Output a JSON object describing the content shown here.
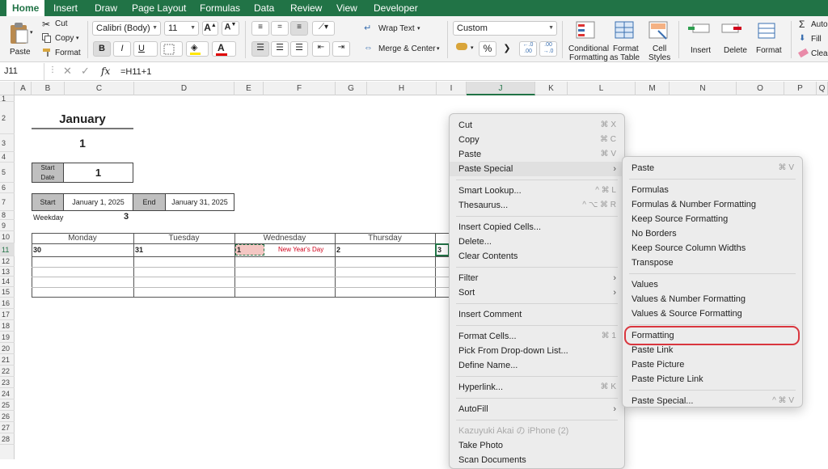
{
  "ribbon_tabs": [
    "Home",
    "Insert",
    "Draw",
    "Page Layout",
    "Formulas",
    "Data",
    "Review",
    "View",
    "Developer"
  ],
  "clipboard": {
    "paste": "Paste",
    "cut": "Cut",
    "copy": "Copy",
    "format": "Format"
  },
  "font": {
    "name": "Calibri (Body)",
    "size": "11",
    "bold": "B",
    "italic": "I",
    "underline": "U",
    "grow": "A",
    "shrink": "A",
    "font_color": "A"
  },
  "alignment": {
    "wrap_text": "Wrap Text",
    "merge_center": "Merge & Center"
  },
  "number": {
    "format": "Custom",
    "percent": "%",
    "comma": "❯",
    "inc_decimal": "←.0\n.00",
    "dec_decimal": ".00\n→.0"
  },
  "styles": {
    "conditional": [
      "Conditional",
      "Formatting"
    ],
    "format_table": [
      "Format",
      "as Table"
    ],
    "cell_styles": [
      "Cell",
      "Styles"
    ]
  },
  "cells": {
    "insert": "Insert",
    "delete": "Delete",
    "format": "Format"
  },
  "editing": {
    "autosum": "Auto",
    "fill": "Fill",
    "clear": "Clear"
  },
  "formula_bar": {
    "name_box": "J11",
    "fx": "fx",
    "formula": "=H11+1"
  },
  "columns": [
    "A",
    "B",
    "C",
    "D",
    "E",
    "F",
    "G",
    "H",
    "I",
    "J",
    "K",
    "L",
    "M",
    "N",
    "O",
    "P",
    "Q"
  ],
  "rows": [
    "1",
    "2",
    "3",
    "4",
    "5",
    "6",
    "7",
    "8",
    "9",
    "10",
    "11",
    "12",
    "13",
    "14",
    "15",
    "16",
    "17",
    "18",
    "19",
    "20",
    "21",
    "22",
    "23",
    "24",
    "25",
    "26",
    "27",
    "28"
  ],
  "sheet": {
    "month": "January",
    "month_number": "1",
    "start_date_label": [
      "Start",
      "Date"
    ],
    "start_date_value": "1",
    "start_label": "Start",
    "start_value": "January 1, 2025",
    "end_label": "End",
    "end_value": "January 31, 2025",
    "weekday_label": "Weekday",
    "weekday_value": "3",
    "day_headers": [
      "Monday",
      "Tuesday",
      "Wednesday",
      "Thursday"
    ],
    "dates": [
      "30",
      "31",
      "1",
      "2",
      "3"
    ],
    "holiday": "New Year's Day"
  },
  "context_menu": [
    {
      "label": "Cut",
      "shortcut": "⌘ X"
    },
    {
      "label": "Copy",
      "shortcut": "⌘ C"
    },
    {
      "label": "Paste",
      "shortcut": "⌘ V"
    },
    {
      "label": "Paste Special",
      "submenu": true
    },
    {
      "sep": true
    },
    {
      "label": "Smart Lookup...",
      "shortcut": "^ ⌘ L"
    },
    {
      "label": "Thesaurus...",
      "shortcut": "^ ⌥ ⌘ R"
    },
    {
      "sep": true
    },
    {
      "label": "Insert Copied Cells..."
    },
    {
      "label": "Delete..."
    },
    {
      "label": "Clear Contents"
    },
    {
      "sep": true
    },
    {
      "label": "Filter",
      "submenu": true
    },
    {
      "label": "Sort",
      "submenu": true
    },
    {
      "sep": true
    },
    {
      "label": "Insert Comment"
    },
    {
      "sep": true
    },
    {
      "label": "Format Cells...",
      "shortcut": "⌘ 1"
    },
    {
      "label": "Pick From Drop-down List..."
    },
    {
      "label": "Define Name..."
    },
    {
      "sep": true
    },
    {
      "label": "Hyperlink...",
      "shortcut": "⌘ K"
    },
    {
      "sep": true
    },
    {
      "label": "AutoFill",
      "submenu": true
    },
    {
      "sep": true
    },
    {
      "label": "Kazuyuki Akai の iPhone (2)",
      "disabled": true
    },
    {
      "label": "Take Photo"
    },
    {
      "label": "Scan Documents"
    }
  ],
  "paste_special_menu": [
    {
      "label": "Paste",
      "shortcut": "⌘ V"
    },
    {
      "sep": true
    },
    {
      "label": "Formulas"
    },
    {
      "label": "Formulas & Number Formatting"
    },
    {
      "label": "Keep Source Formatting"
    },
    {
      "label": "No Borders"
    },
    {
      "label": "Keep Source Column Widths"
    },
    {
      "label": "Transpose"
    },
    {
      "sep": true
    },
    {
      "label": "Values"
    },
    {
      "label": "Values & Number Formatting"
    },
    {
      "label": "Values & Source Formatting"
    },
    {
      "sep": true
    },
    {
      "label": "Formatting",
      "circled": true
    },
    {
      "label": "Paste Link"
    },
    {
      "label": "Paste Picture"
    },
    {
      "label": "Paste Picture Link"
    },
    {
      "sep": true
    },
    {
      "label": "Paste Special...",
      "shortcut": "^ ⌘ V"
    }
  ],
  "colors": {
    "excel_green": "#217346",
    "holiday_red": "#d0021b",
    "highlight_circle": "#d9363e",
    "copied_fill": "#f4c7c3",
    "label_gray": "#bfbfbf"
  }
}
